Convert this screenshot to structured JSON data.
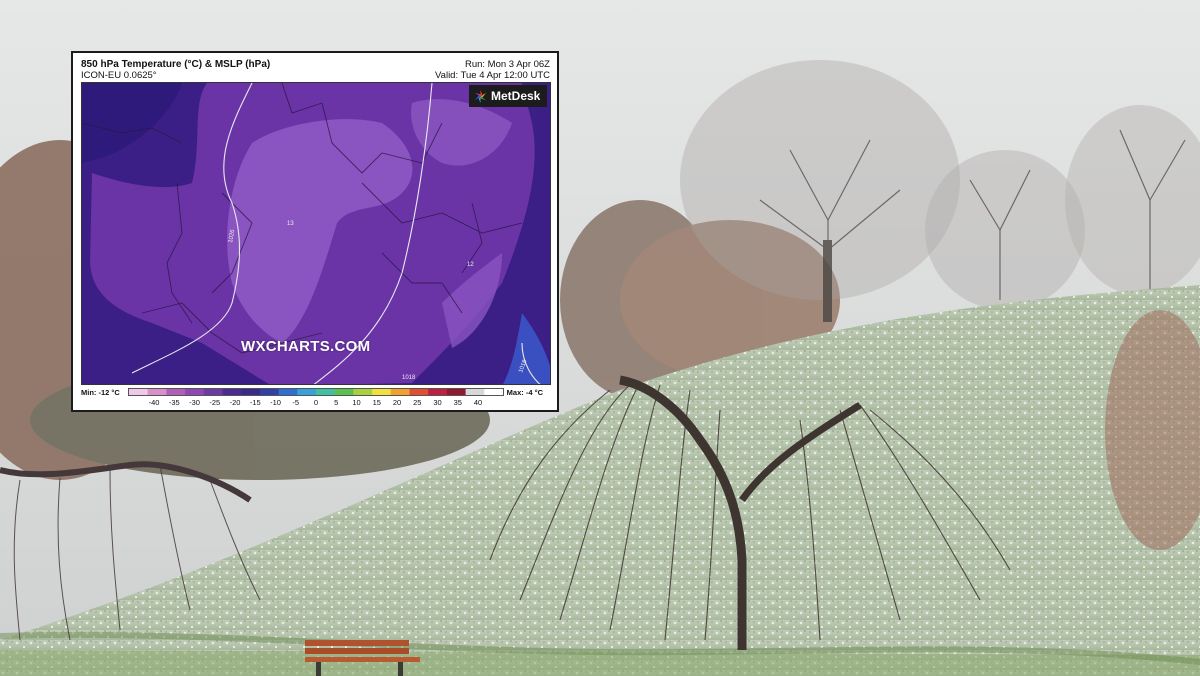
{
  "map": {
    "title": "850 hPa Temperature (°C) & MSLP (hPa)",
    "model": "ICON-EU 0.0625°",
    "run": "Run: Mon 3 Apr 06Z",
    "valid": "Valid: Tue 4 Apr 12:00 UTC",
    "brand": "MetDesk",
    "watermark": "WXCHARTS.COM",
    "isobar_labels": [
      "1026",
      "13",
      "12",
      "1018",
      "1018"
    ],
    "legend": {
      "min_label": "Min: -12 °C",
      "max_label": "Max: -4 °C",
      "ticks": [
        "-40",
        "-35",
        "-30",
        "-25",
        "-20",
        "-15",
        "-10",
        "-5",
        "0",
        "5",
        "10",
        "15",
        "20",
        "25",
        "30",
        "35",
        "40"
      ],
      "colors": [
        "#f0c8e8",
        "#d890c8",
        "#b060b8",
        "#8f48b4",
        "#6e3aa6",
        "#4c2c92",
        "#3b2a8a",
        "#3340a8",
        "#2f6fd0",
        "#3aa0d8",
        "#40c0a0",
        "#5cc050",
        "#a8d040",
        "#f0e040",
        "#f0a030",
        "#e05030",
        "#c02040",
        "#901830",
        "#d8d8d8",
        "#ffffff"
      ]
    }
  },
  "colors": {
    "sky": "#dcdddd",
    "snowy_grass": "#b7c6ad",
    "grass": "#7d9c5c",
    "bench_wood": "#b0522e",
    "map_purple_dark": "#3a1a80",
    "map_purple_mid": "#6a34a6",
    "map_purple_light": "#8c55bf"
  }
}
